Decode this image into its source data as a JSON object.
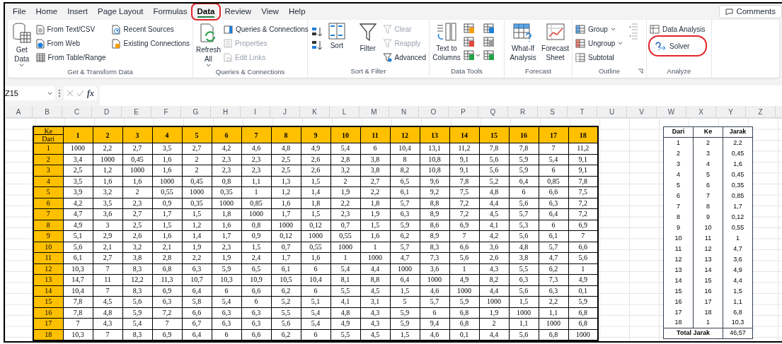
{
  "ribbon_tabs": [
    {
      "label": "File",
      "selected": false,
      "circled": false
    },
    {
      "label": "Home",
      "selected": false,
      "circled": false
    },
    {
      "label": "Insert",
      "selected": false,
      "circled": false
    },
    {
      "label": "Page Layout",
      "selected": false,
      "circled": false
    },
    {
      "label": "Formulas",
      "selected": false,
      "circled": false
    },
    {
      "label": "Data",
      "selected": true,
      "circled": true
    },
    {
      "label": "Review",
      "selected": false,
      "circled": false
    },
    {
      "label": "View",
      "selected": false,
      "circled": false
    },
    {
      "label": "Help",
      "selected": false,
      "circled": false
    }
  ],
  "comments_button": "Comments",
  "ribbon_groups": [
    {
      "label": "Get & Transform Data",
      "items": [
        {
          "label": "Get Data",
          "disabled": false
        },
        {
          "label": "From Text/CSV",
          "disabled": false
        },
        {
          "label": "From Web",
          "disabled": false
        },
        {
          "label": "From Table/Range",
          "disabled": false
        },
        {
          "label": "Recent Sources",
          "disabled": false
        },
        {
          "label": "Existing Connections",
          "disabled": false
        }
      ]
    },
    {
      "label": "Queries & Connections",
      "items": [
        {
          "label": "Refresh All",
          "disabled": false
        },
        {
          "label": "Queries & Connections",
          "disabled": false
        },
        {
          "label": "Properties",
          "disabled": true
        },
        {
          "label": "Edit Links",
          "disabled": true
        }
      ]
    },
    {
      "label": "Sort & Filter",
      "items": [
        {
          "label": "Sort",
          "disabled": false
        },
        {
          "label": "Filter",
          "disabled": false
        },
        {
          "label": "Clear",
          "disabled": true
        },
        {
          "label": "Reapply",
          "disabled": true
        },
        {
          "label": "Advanced",
          "disabled": false
        }
      ]
    },
    {
      "label": "Data Tools",
      "items": [
        {
          "label": "Text to Columns",
          "disabled": false
        }
      ]
    },
    {
      "label": "Forecast",
      "items": [
        {
          "label": "What-If Analysis",
          "disabled": false
        },
        {
          "label": "Forecast Sheet",
          "disabled": false
        }
      ]
    },
    {
      "label": "Outline",
      "items": [
        {
          "label": "Group",
          "disabled": false
        },
        {
          "label": "Ungroup",
          "disabled": false
        },
        {
          "label": "Subtotal",
          "disabled": false
        }
      ]
    },
    {
      "label": "Analyze",
      "items": [
        {
          "label": "Data Analysis",
          "disabled": false,
          "circled": false
        },
        {
          "label": "Solver",
          "disabled": false,
          "circled": true
        }
      ]
    }
  ],
  "formula_bar": {
    "name_box": "Z15",
    "function_label": "fx"
  },
  "column_headers": [
    "A",
    "B",
    "C",
    "D",
    "E",
    "F",
    "G",
    "H",
    "I",
    "J",
    "K",
    "L",
    "M",
    "N",
    "O",
    "P",
    "Q",
    "R",
    "S",
    "T",
    "U",
    "V",
    "W",
    "X",
    "Y",
    "Z"
  ],
  "matrix": {
    "corner_top": "Ke",
    "corner_bottom": "Dari",
    "columns": [
      "1",
      "2",
      "3",
      "4",
      "5",
      "6",
      "7",
      "8",
      "9",
      "10",
      "11",
      "12",
      "13",
      "14",
      "15",
      "16",
      "17",
      "18"
    ],
    "rows": [
      {
        "label": "1",
        "cells": [
          "1000",
          "2,2",
          "2,7",
          "3,5",
          "2,7",
          "4,2",
          "4,6",
          "4,8",
          "4,9",
          "5,4",
          "6",
          "10,4",
          "13,1",
          "11,2",
          "7,8",
          "7,8",
          "7",
          "11,2"
        ]
      },
      {
        "label": "2",
        "cells": [
          "3,4",
          "1000",
          "0,45",
          "1,6",
          "2",
          "2,3",
          "2,3",
          "2,5",
          "2,6",
          "2,8",
          "3,8",
          "8",
          "10,8",
          "9,1",
          "5,6",
          "5,9",
          "5,4",
          "9,1"
        ]
      },
      {
        "label": "3",
        "cells": [
          "2,5",
          "1,2",
          "1000",
          "1,6",
          "2",
          "2,3",
          "2,3",
          "2,5",
          "2,6",
          "3,2",
          "3,8",
          "8,2",
          "10,8",
          "9,1",
          "5,6",
          "5,9",
          "6",
          "9,1"
        ]
      },
      {
        "label": "4",
        "cells": [
          "3,5",
          "1,6",
          "1,6",
          "1000",
          "0,45",
          "0,8",
          "1,1",
          "1,3",
          "1,5",
          "2",
          "2,7",
          "6,5",
          "9,6",
          "7,8",
          "5,2",
          "6,4",
          "0,85",
          "7,8"
        ]
      },
      {
        "label": "5",
        "cells": [
          "3,9",
          "3,2",
          "2",
          "0,55",
          "1000",
          "0,35",
          "1",
          "1,2",
          "1,4",
          "1,9",
          "2,2",
          "6,1",
          "9,2",
          "7,5",
          "4,8",
          "6",
          "6,6",
          "7,5"
        ]
      },
      {
        "label": "6",
        "cells": [
          "4,2",
          "3,5",
          "2,3",
          "0,9",
          "0,35",
          "1000",
          "0,85",
          "1,6",
          "1,8",
          "2,2",
          "1,8",
          "5,7",
          "8,8",
          "7,2",
          "4,4",
          "5,6",
          "6,3",
          "7,2"
        ]
      },
      {
        "label": "7",
        "cells": [
          "4,7",
          "3,6",
          "2,7",
          "1,7",
          "1,5",
          "1,8",
          "1000",
          "1,7",
          "1,5",
          "2,3",
          "1,9",
          "6,3",
          "8,9",
          "7,2",
          "4,5",
          "5,7",
          "6,4",
          "7,2"
        ]
      },
      {
        "label": "8",
        "cells": [
          "4,9",
          "3",
          "2,5",
          "1,5",
          "1,2",
          "1,6",
          "0,8",
          "1000",
          "0,12",
          "0,7",
          "1,5",
          "5,9",
          "8,6",
          "6,9",
          "4,1",
          "5,3",
          "6",
          "6,9"
        ]
      },
      {
        "label": "9",
        "cells": [
          "5,1",
          "2,9",
          "2,6",
          "1,6",
          "1,4",
          "1,7",
          "0,9",
          "0,12",
          "1000",
          "0,55",
          "1,6",
          "6,2",
          "8,9",
          "7",
          "4,2",
          "5,6",
          "6,1",
          "7"
        ]
      },
      {
        "label": "10",
        "cells": [
          "5,6",
          "2,1",
          "3,2",
          "2,1",
          "1,9",
          "2,3",
          "1,5",
          "0,7",
          "0,55",
          "1000",
          "1",
          "5,7",
          "8,3",
          "6,6",
          "3,6",
          "4,8",
          "5,7",
          "6,6"
        ]
      },
      {
        "label": "11",
        "cells": [
          "6,1",
          "2,7",
          "3,8",
          "2,8",
          "2,2",
          "1,9",
          "2,4",
          "1,7",
          "1,6",
          "1",
          "1000",
          "4,7",
          "7,3",
          "5,6",
          "2,6",
          "3,8",
          "4,7",
          "5,6"
        ]
      },
      {
        "label": "12",
        "cells": [
          "10,3",
          "7",
          "8,3",
          "6,8",
          "6,3",
          "5,9",
          "6,5",
          "6,1",
          "6",
          "5,4",
          "4,4",
          "1000",
          "3,6",
          "1",
          "4,3",
          "5,5",
          "6,2",
          "1"
        ]
      },
      {
        "label": "13",
        "cells": [
          "14,7",
          "11",
          "12,2",
          "11,3",
          "10,7",
          "10,3",
          "10,9",
          "10,5",
          "10,4",
          "8,1",
          "8,8",
          "6,4",
          "1000",
          "4,9",
          "8,2",
          "6,3",
          "7,3",
          "4,9"
        ]
      },
      {
        "label": "14",
        "cells": [
          "10,4",
          "7",
          "8,3",
          "6,9",
          "6,4",
          "6",
          "6,6",
          "6,2",
          "6",
          "5,5",
          "4,5",
          "1,5",
          "4,6",
          "1000",
          "4,4",
          "5,6",
          "6,3",
          "0,1"
        ]
      },
      {
        "label": "15",
        "cells": [
          "7,8",
          "4,5",
          "5,6",
          "6,3",
          "5,8",
          "5,4",
          "6",
          "5,2",
          "5,1",
          "4,1",
          "3,1",
          "5",
          "5,7",
          "5,9",
          "1000",
          "1,5",
          "2,2",
          "5,9"
        ]
      },
      {
        "label": "16",
        "cells": [
          "7,8",
          "4,8",
          "5,9",
          "7,2",
          "6,6",
          "6,3",
          "6,3",
          "5,5",
          "5,4",
          "4,8",
          "4,3",
          "5,9",
          "6",
          "6,8",
          "1,9",
          "1000",
          "1,1",
          "6,8"
        ]
      },
      {
        "label": "17",
        "cells": [
          "7",
          "4,3",
          "5,4",
          "7",
          "6,7",
          "6,3",
          "6,3",
          "5,6",
          "5,4",
          "4,9",
          "4,3",
          "5,9",
          "9,4",
          "6,8",
          "2",
          "1,1",
          "1000",
          "6,8"
        ]
      },
      {
        "label": "18",
        "cells": [
          "10,3",
          "7",
          "8,3",
          "6,9",
          "6,4",
          "6",
          "6,6",
          "6,2",
          "6",
          "5,5",
          "4,5",
          "1,5",
          "4,6",
          "0,1",
          "4,4",
          "5,6",
          "6,8",
          "1000"
        ]
      }
    ]
  },
  "route_table": {
    "columns": [
      "Dari",
      "Ke",
      "Jarak"
    ],
    "rows": [
      [
        "1",
        "2",
        "2,2"
      ],
      [
        "2",
        "3",
        "0,45"
      ],
      [
        "3",
        "4",
        "1,6"
      ],
      [
        "4",
        "5",
        "0,45"
      ],
      [
        "5",
        "6",
        "0,35"
      ],
      [
        "6",
        "7",
        "0,85"
      ],
      [
        "7",
        "8",
        "1,7"
      ],
      [
        "8",
        "9",
        "0,12"
      ],
      [
        "9",
        "10",
        "0,55"
      ],
      [
        "10",
        "11",
        "1"
      ],
      [
        "11",
        "12",
        "4,7"
      ],
      [
        "12",
        "13",
        "3,6"
      ],
      [
        "13",
        "14",
        "4,9"
      ],
      [
        "14",
        "15",
        "4,4"
      ],
      [
        "15",
        "16",
        "1,5"
      ],
      [
        "16",
        "17",
        "1,1"
      ],
      [
        "17",
        "18",
        "6,8"
      ],
      [
        "18",
        "1",
        "10,3"
      ]
    ],
    "total_label": "Total Jarak",
    "total_value": "46,57"
  }
}
